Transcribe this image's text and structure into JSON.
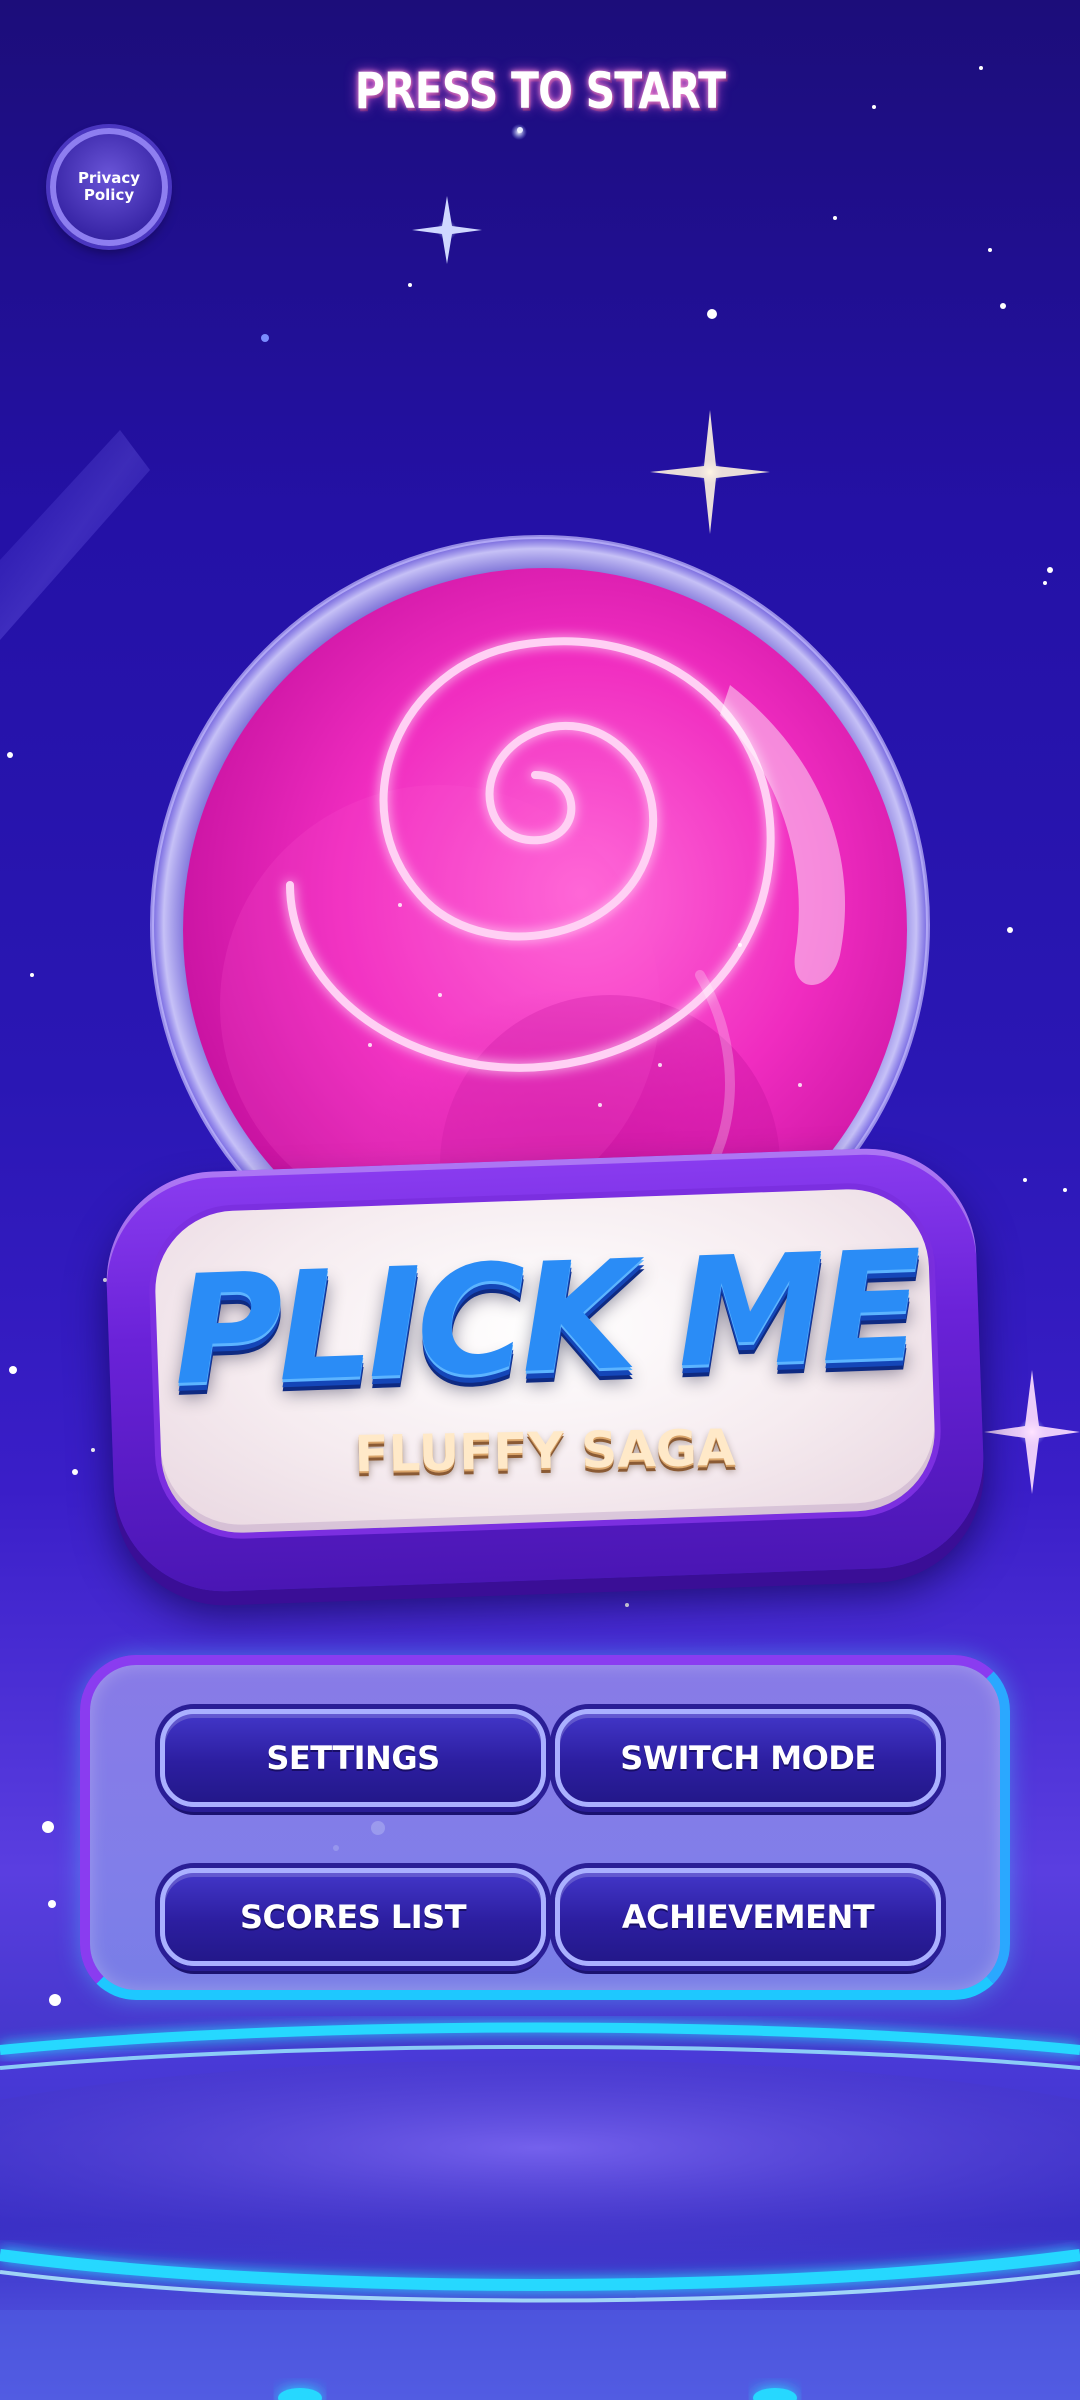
{
  "header": {
    "press_to_start": "PRESS TO START"
  },
  "privacy": {
    "label": "Privacy Policy"
  },
  "logo": {
    "title": "PLICK ME",
    "subtitle": "FLUFFY SAGA"
  },
  "menu": {
    "settings": "SETTINGS",
    "switch_mode": "SWITCH MODE",
    "scores_list": "SCORES LIST",
    "achievement": "ACHIEVEMENT"
  },
  "colors": {
    "background": "#2411a6",
    "orb_pink": "#ff3cc8",
    "logo_blue": "#2a8cf6",
    "button_fill": "#2c1ea0",
    "neon_cyan": "#28d8ff"
  }
}
